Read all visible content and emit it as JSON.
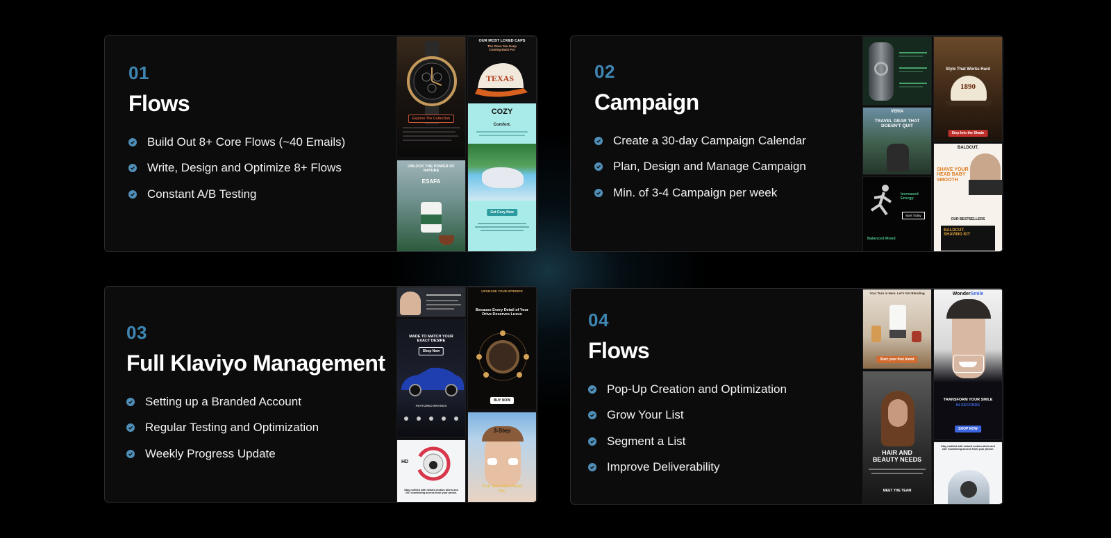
{
  "cards": [
    {
      "number": "01",
      "title": "Flows",
      "items": [
        "Build Out 8+ Core Flows (~40 Emails)",
        "Write, Design and Optimize 8+ Flows",
        "Constant A/B Testing"
      ]
    },
    {
      "number": "02",
      "title": "Campaign",
      "items": [
        "Create a 30-day Campaign Calendar",
        "Plan, Design and Manage Campaign",
        "Min. of 3-4 Campaign per week"
      ]
    },
    {
      "number": "03",
      "title": "Full Klaviyo Management",
      "items": [
        "Setting up a Branded Account",
        "Regular Testing and Optimization",
        "Weekly Progress Update"
      ]
    },
    {
      "number": "04",
      "title": "Flows",
      "items": [
        "Pop-Up Creation and Optimization",
        "Grow Your List",
        "Segment a List",
        "Improve Deliverability"
      ]
    }
  ],
  "thumbnails": {
    "card1": {
      "caps_title": "OUR MOST LOVED CAPS",
      "caps_sub": "The Ones You Keep Coming Back For",
      "caps_brand": "TEXAS",
      "watch_button": "Explore The Collection",
      "cozy_title": "COZY",
      "cozy_sub": "Comfort.",
      "cozy_button": "Get Cozy Now",
      "esafa_title": "UNLOCK THE POWER OF NATURE",
      "esafa_brand": "ESAFA"
    },
    "card2": {
      "veria_brand": "VERIA",
      "veria_title": "TRAVEL GEAR THAT DOESN'T QUIT",
      "cap_title": "Style That Works Hard",
      "cap_badge": "1890",
      "cap_button": "Step Into the Shade",
      "energy_title": "Increased Energy",
      "energy_button": "Start Today",
      "mood_title": "Balanced Mood",
      "baldcut_brand": "BALDCUT.",
      "baldcut_shave": "SHAVE YOUR HEAD BABY SMOOTH",
      "baldcut_best": "OUR BESTSELLERS",
      "baldcut_kit": "BALDCUT. SHAVING KIT"
    },
    "card3": {
      "car_title": "MADE TO MATCH YOUR EXACT DESIRE",
      "car_button": "Shop Now",
      "car_brands": "FEATURED BRANDS",
      "interior_label": "UPGRADE YOUR INTERIOR",
      "interior_title": "Because Every Detail of Your Drive Deserves Luxus",
      "interior_button": "BUY NOW",
      "cam_label": "HD",
      "cam_text": "Stay notified with instant motion alerts and 24/7 monitoring access from your phone.",
      "skin_title": "3-Step",
      "skin_sub": "Your Skin Will Thank You"
    },
    "card4": {
      "blend_label": "Your Turn is Here. Let's Get Blending",
      "blend_button": "Start your first blend",
      "hair_title": "HAIR AND BEAUTY NEEDS",
      "hair_button": "MEET THE TEAM",
      "smile_brand": "Wonder",
      "smile_brand2": "Smile",
      "smile_title": "TRANSFORM YOUR SMILE",
      "smile_sub": "IN SECONDS",
      "smile_button": "SHOP NOW",
      "cam_text": "Stay notified with instant motion alerts and 24/7 monitoring access from your phone."
    }
  },
  "colors": {
    "accent": "#3f86b3",
    "check": "#4f8fb8",
    "card_bg": "#0c0c0d",
    "page_bg": "#000000"
  },
  "icons": {
    "bullet": "check-circle-icon"
  }
}
